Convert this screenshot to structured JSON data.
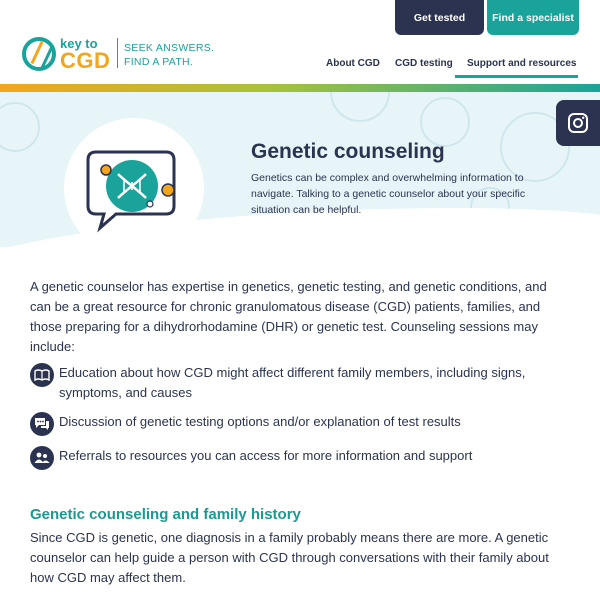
{
  "header": {
    "logo_key_to": "key to",
    "logo_cgd": "CGD",
    "tagline_line1": "SEEK ANSWERS.",
    "tagline_line2": "FIND A PATH.",
    "get_tested_label": "Get tested",
    "find_specialist_label": "Find a specialist",
    "nav": {
      "about": "About CGD",
      "testing": "CGD testing",
      "support": "Support and resources"
    }
  },
  "hero": {
    "title": "Genetic counseling",
    "description": "Genetics can be complex and overwhelming information to navigate. Talking to a genetic counselor about your specific situation can be helpful."
  },
  "social": {
    "instagram_icon": "instagram-icon"
  },
  "main": {
    "intro": "A genetic counselor has expertise in genetics, genetic testing, and genetic conditions, and can be a great resource for chronic granulomatous disease (CGD) patients, families, and those preparing for a dihydrorhodamine (DHR) or genetic test. Counseling sessions may include:",
    "bullets": [
      {
        "icon": "book-icon",
        "text": "Education about how CGD might affect different family members, including signs, symptoms, and causes"
      },
      {
        "icon": "chat-icon",
        "text": "Discussion of genetic testing options and/or explanation of test results"
      },
      {
        "icon": "people-icon",
        "text": "Referrals to resources you can access for more information and support"
      }
    ],
    "section_heading": "Genetic counseling and family history",
    "section_body": "Since CGD is genetic, one diagnosis in a family probably means there are more. A genetic counselor can help guide a person with CGD through conversations with their family about how CGD may affect them."
  },
  "colors": {
    "navy": "#2b3350",
    "teal": "#1aa39a",
    "orange": "#f3a51c",
    "hero_bg": "#e8f5f8"
  }
}
